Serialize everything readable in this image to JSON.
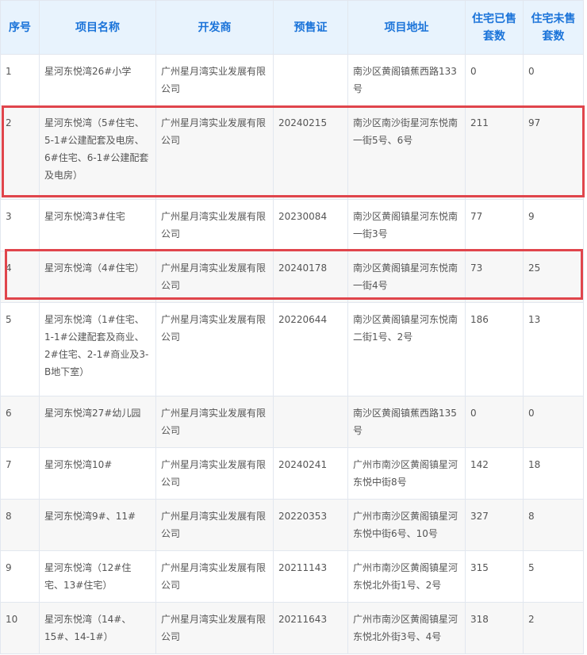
{
  "table": {
    "headers": [
      "序号",
      "项目名称",
      "开发商",
      "预售证",
      "项目地址",
      "住宅已售套数",
      "住宅未售套数"
    ],
    "rows": [
      {
        "no": "1",
        "name": "星河东悦湾26#小学",
        "developer": "广州星月湾实业发展有限公司",
        "permit": "",
        "address": "南沙区黄阁镇蕉西路133号",
        "sold": "0",
        "unsold": "0"
      },
      {
        "no": "2",
        "name": "星河东悦湾（5#住宅、5-1#公建配套及电房、6#住宅、6-1#公建配套及电房）",
        "developer": "广州星月湾实业发展有限公司",
        "permit": "20240215",
        "address": "南沙区南沙街星河东悦南一街5号、6号",
        "sold": "211",
        "unsold": "97"
      },
      {
        "no": "3",
        "name": "星河东悦湾3#住宅",
        "developer": "广州星月湾实业发展有限公司",
        "permit": "20230084",
        "address": "南沙区黄阁镇星河东悦南一街3号",
        "sold": "77",
        "unsold": "9"
      },
      {
        "no": "4",
        "name": "星河东悦湾（4#住宅）",
        "developer": "广州星月湾实业发展有限公司",
        "permit": "20240178",
        "address": "南沙区黄阁镇星河东悦南一街4号",
        "sold": "73",
        "unsold": "25"
      },
      {
        "no": "5",
        "name": "星河东悦湾（1#住宅、1-1#公建配套及商业、2#住宅、2-1#商业及3-B地下室）",
        "developer": "广州星月湾实业发展有限公司",
        "permit": "20220644",
        "address": "南沙区黄阁镇星河东悦南二街1号、2号",
        "sold": "186",
        "unsold": "13"
      },
      {
        "no": "6",
        "name": "星河东悦湾27#幼儿园",
        "developer": "广州星月湾实业发展有限公司",
        "permit": "",
        "address": "南沙区黄阁镇蕉西路135号",
        "sold": "0",
        "unsold": "0"
      },
      {
        "no": "7",
        "name": "星河东悦湾10#",
        "developer": "广州星月湾实业发展有限公司",
        "permit": "20240241",
        "address": "广州市南沙区黄阁镇星河东悦中街8号",
        "sold": "142",
        "unsold": "18"
      },
      {
        "no": "8",
        "name": "星河东悦湾9#、11#",
        "developer": "广州星月湾实业发展有限公司",
        "permit": "20220353",
        "address": "广州市南沙区黄阁镇星河东悦中街6号、10号",
        "sold": "327",
        "unsold": "8"
      },
      {
        "no": "9",
        "name": "星河东悦湾（12#住宅、13#住宅）",
        "developer": "广州星月湾实业发展有限公司",
        "permit": "20211143",
        "address": "广州市南沙区黄阁镇星河东悦北外街1号、2号",
        "sold": "315",
        "unsold": "5"
      },
      {
        "no": "10",
        "name": "星河东悦湾（14#、15#、14-1#）",
        "developer": "广州星月湾实业发展有限公司",
        "permit": "20211643",
        "address": "广州市南沙区黄阁镇星河东悦北外街3号、4号",
        "sold": "318",
        "unsold": "2"
      }
    ]
  },
  "highlight_color": "#e0454c"
}
